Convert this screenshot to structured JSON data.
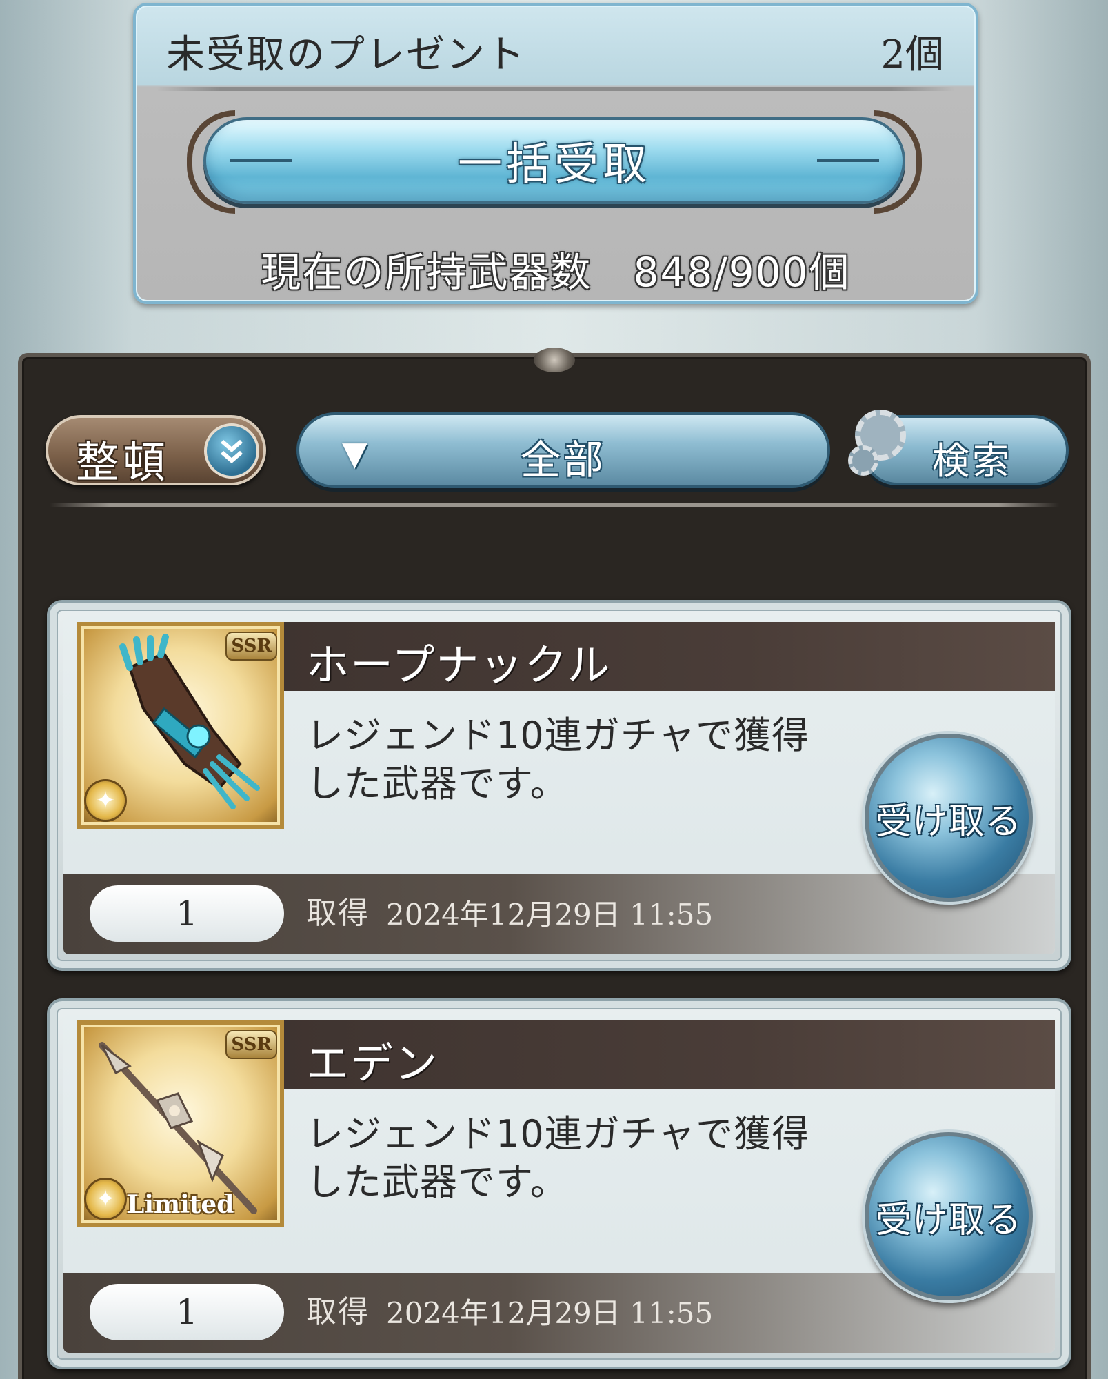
{
  "present_header": {
    "title": "未受取のプレゼント",
    "count": "2個",
    "bulk_receive_label": "一括受取",
    "weapon_count_text": "現在の所持武器数　848/900個"
  },
  "toolbar": {
    "sort_label": "整頓",
    "filter_label": "全部",
    "search_label": "検索"
  },
  "presents": [
    {
      "name": "ホープナックル",
      "rarity": "SSR",
      "limited_label": "",
      "description": "レジェンド10連ガチャで獲得した武器です。",
      "quantity": "1",
      "acquired_label": "取得",
      "acquired_date": "2024年12月29日 11:55",
      "receive_label": "受け取る"
    },
    {
      "name": "エデン",
      "rarity": "SSR",
      "limited_label": "Limited",
      "description": "レジェンド10連ガチャで獲得した武器です。",
      "quantity": "1",
      "acquired_label": "取得",
      "acquired_date": "2024年12月29日 11:55",
      "receive_label": "受け取る"
    }
  ],
  "icons": {
    "sort_toggle": "double-chevron-down-icon",
    "filter_arrow": "triangle-down-icon",
    "search": "gear-icon",
    "element_badge": "light-element-icon"
  },
  "colors": {
    "accent_blue": "#5fb5d4",
    "panel_dark": "#2a2622",
    "gold": "#c89a44"
  }
}
